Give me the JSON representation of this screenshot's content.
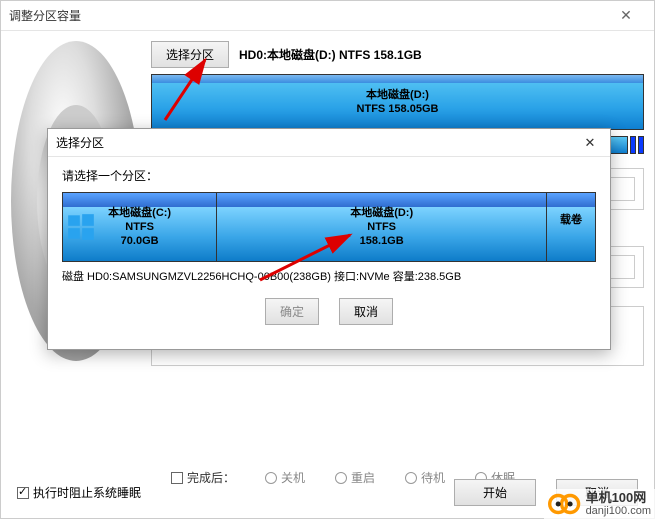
{
  "window": {
    "title": "调整分区容量"
  },
  "select_button": "选择分区",
  "selected_partition": "HD0:本地磁盘(D:) NTFS 158.1GB",
  "main_partition": {
    "name": "本地磁盘(D:)",
    "fs_size": "NTFS 158.05GB"
  },
  "modal": {
    "title": "选择分区",
    "hint": "请选择一个分区：",
    "parts": [
      {
        "name": "本地磁盘(C:)",
        "fs": "NTFS",
        "size": "70.0GB",
        "width_pct": 29,
        "win": true
      },
      {
        "name": "本地磁盘(D:)",
        "fs": "NTFS",
        "size": "158.1GB",
        "width_pct": 62,
        "win": false
      },
      {
        "name": "载卷",
        "fs": "",
        "size": "",
        "width_pct": 9,
        "win": false
      }
    ],
    "disk_info": "磁盘 HD0:SAMSUNGMZVL2256HCHQ-00B00(238GB) 接口:NVMe 容量:238.5GB",
    "ok": "确定",
    "cancel": "取消"
  },
  "options": {
    "after_label": "完成后：",
    "shutdown": "关机",
    "reboot": "重启",
    "standby": "待机",
    "hibernate": "休眠"
  },
  "bottom": {
    "sleep_block": "执行时阻止系统睡眠",
    "start": "开始",
    "cancel": "取消"
  },
  "watermark": {
    "cn": "单机100网",
    "domain": "danji100.com"
  }
}
